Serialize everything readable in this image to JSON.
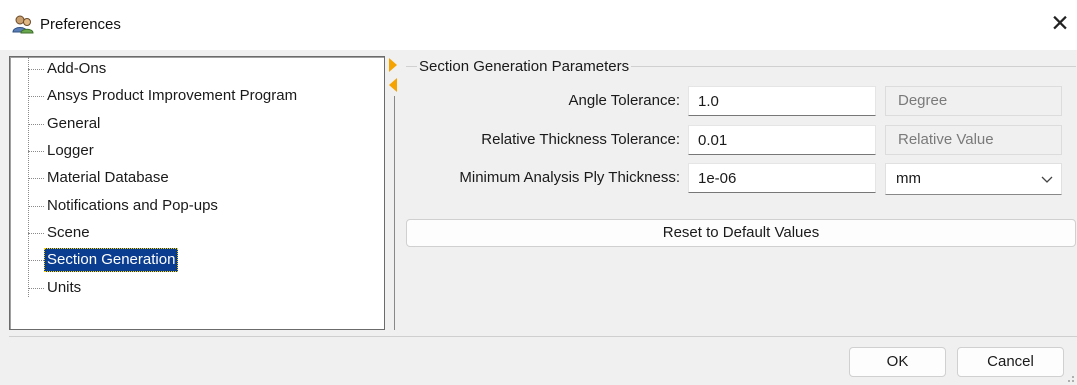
{
  "window": {
    "title": "Preferences",
    "close_glyph": "✕"
  },
  "tree": {
    "items": [
      {
        "label": "Add-Ons"
      },
      {
        "label": "Ansys Product Improvement Program"
      },
      {
        "label": "General"
      },
      {
        "label": "Logger"
      },
      {
        "label": "Material Database"
      },
      {
        "label": "Notifications and Pop-ups"
      },
      {
        "label": "Scene"
      },
      {
        "label": "Section Generation",
        "selected": true
      },
      {
        "label": "Units"
      }
    ]
  },
  "section": {
    "title": "Section Generation Parameters",
    "angle": {
      "label": "Angle Tolerance:",
      "value": "1.0",
      "unit": "Degree"
    },
    "thickness": {
      "label": "Relative Thickness Tolerance:",
      "value": "0.01",
      "unit": "Relative Value"
    },
    "ply": {
      "label": "Minimum Analysis Ply Thickness:",
      "value": "1e-06",
      "unit": "mm"
    },
    "reset_label": "Reset to Default Values"
  },
  "footer": {
    "ok_label": "OK",
    "cancel_label": "Cancel"
  },
  "colors": {
    "selection": "#0a3d8f",
    "splitter_arrow": "#f5a300"
  },
  "icons": {
    "app": "people-icon",
    "close": "close-icon",
    "dropdown": "chevron-down-icon"
  }
}
